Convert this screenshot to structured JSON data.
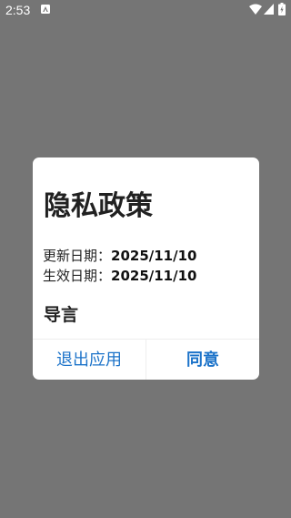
{
  "status_bar": {
    "time": "2:53",
    "notification_icon": "app-notification-icon",
    "wifi_icon": "wifi-icon",
    "signal_icon": "cell-signal-icon",
    "battery_icon": "battery-icon"
  },
  "dialog": {
    "title": "隐私政策",
    "updated_label": "更新日期：",
    "updated_date": "2025/11/10",
    "effective_label": "生效日期：",
    "effective_date": "2025/11/10",
    "section_heading": "导言",
    "exit_button": "退出应用",
    "agree_button": "同意"
  },
  "colors": {
    "overlay": "#757575",
    "dialog_background": "#ffffff",
    "button_text": "#1c73c9",
    "title_text": "#212121"
  }
}
